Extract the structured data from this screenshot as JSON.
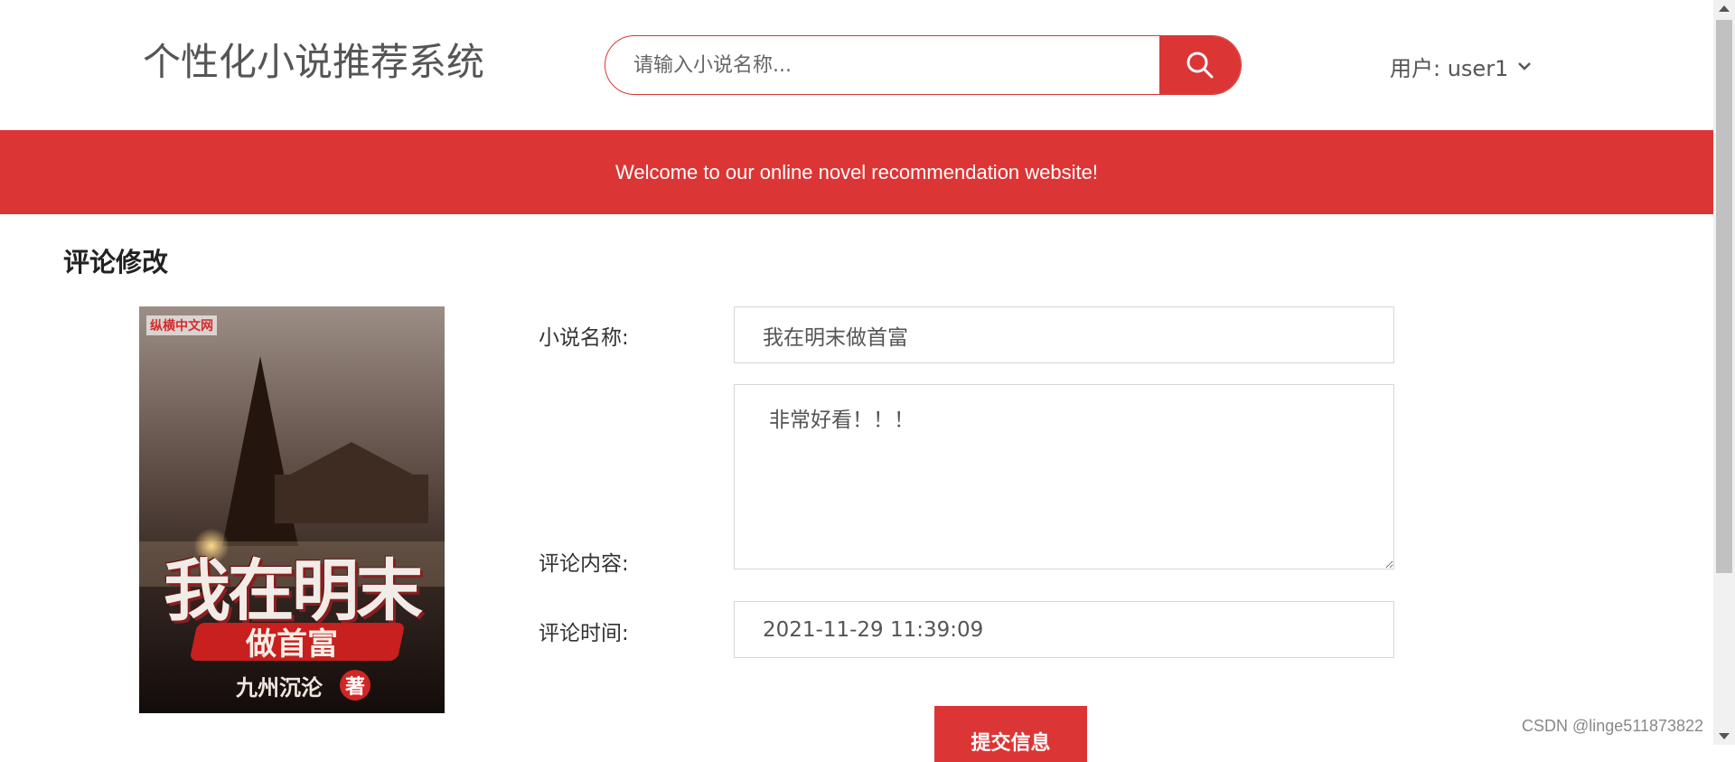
{
  "header": {
    "site_title": "个性化小说推荐系统",
    "search": {
      "placeholder": "请输入小说名称...",
      "value": ""
    },
    "search_icon": "search-icon",
    "user_label": "用户: user1",
    "user_menu_icon": "chevron-down-icon"
  },
  "banner": {
    "text": "Welcome to our online novel recommendation website!"
  },
  "main": {
    "section_title": "评论修改",
    "cover": {
      "publisher": "纵横中文网",
      "title_big": "我在明末",
      "title_sub": "做首富",
      "author": "九州沉沦",
      "author_seal": "著"
    },
    "form": {
      "novel_name_label": "小说名称:",
      "novel_name_value": "我在明末做首富",
      "comment_label": "评论内容:",
      "comment_value": "非常好看！！！",
      "time_label": "评论时间:",
      "time_value": "2021-11-29 11:39:09",
      "submit_label": "提交信息"
    }
  },
  "watermark": "CSDN @linge511873822",
  "colors": {
    "accent": "#dc3535",
    "text": "#333333",
    "muted": "#555555"
  }
}
